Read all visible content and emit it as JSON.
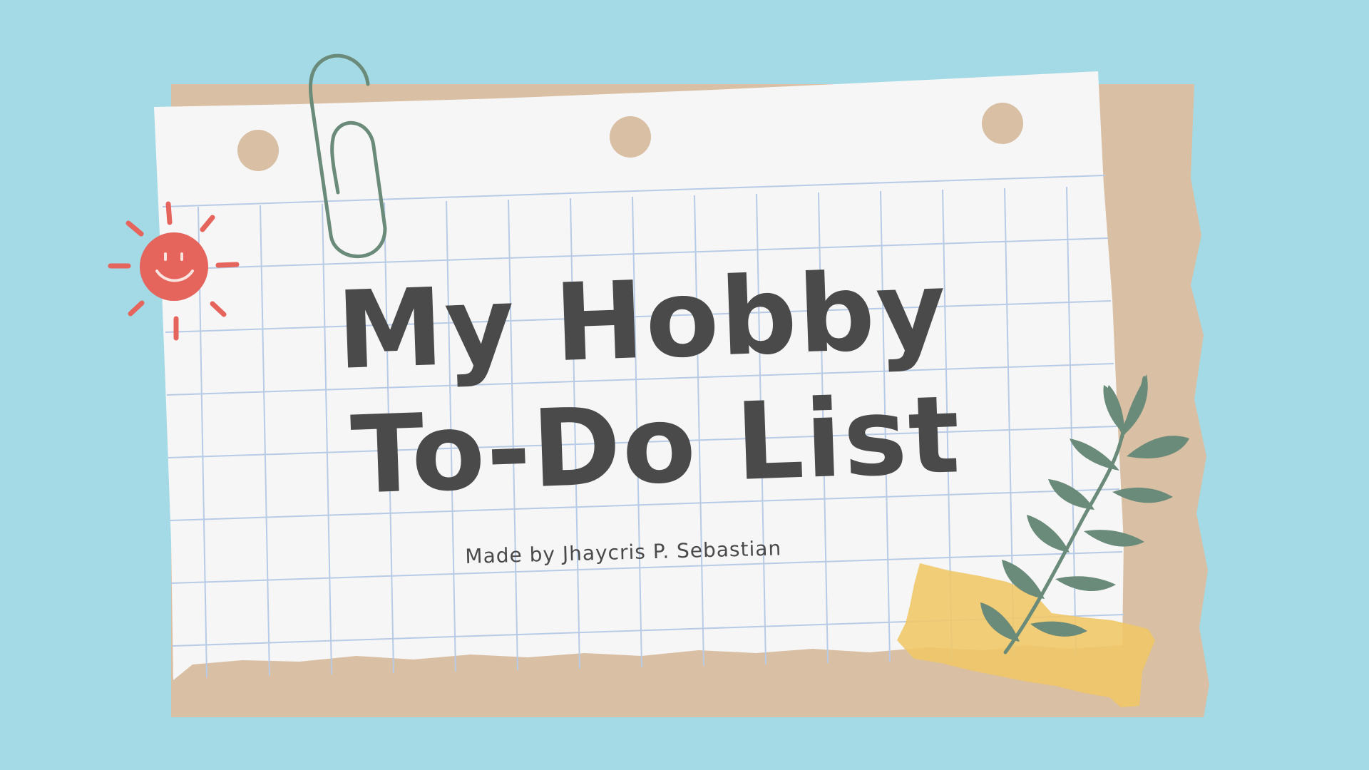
{
  "slide": {
    "title_line_1": "My Hobby",
    "title_line_2": "To-Do List",
    "subtitle": "Made by Jhaycris P. Sebastian"
  },
  "decor": {
    "icons": [
      "paperclip-icon",
      "sun-icon",
      "leaf-branch-icon",
      "tape-strip",
      "punch-holes"
    ]
  },
  "colors": {
    "background": "#a3dae6",
    "kraft_paper": "#d9bfa3",
    "grid_paper": "#f6f6f6",
    "grid_lines": "#b8cbe6",
    "title_text": "#4a4a4a",
    "sun": "#e5645c",
    "leaves": "#6b8b7a",
    "tape": "#f0c766"
  }
}
